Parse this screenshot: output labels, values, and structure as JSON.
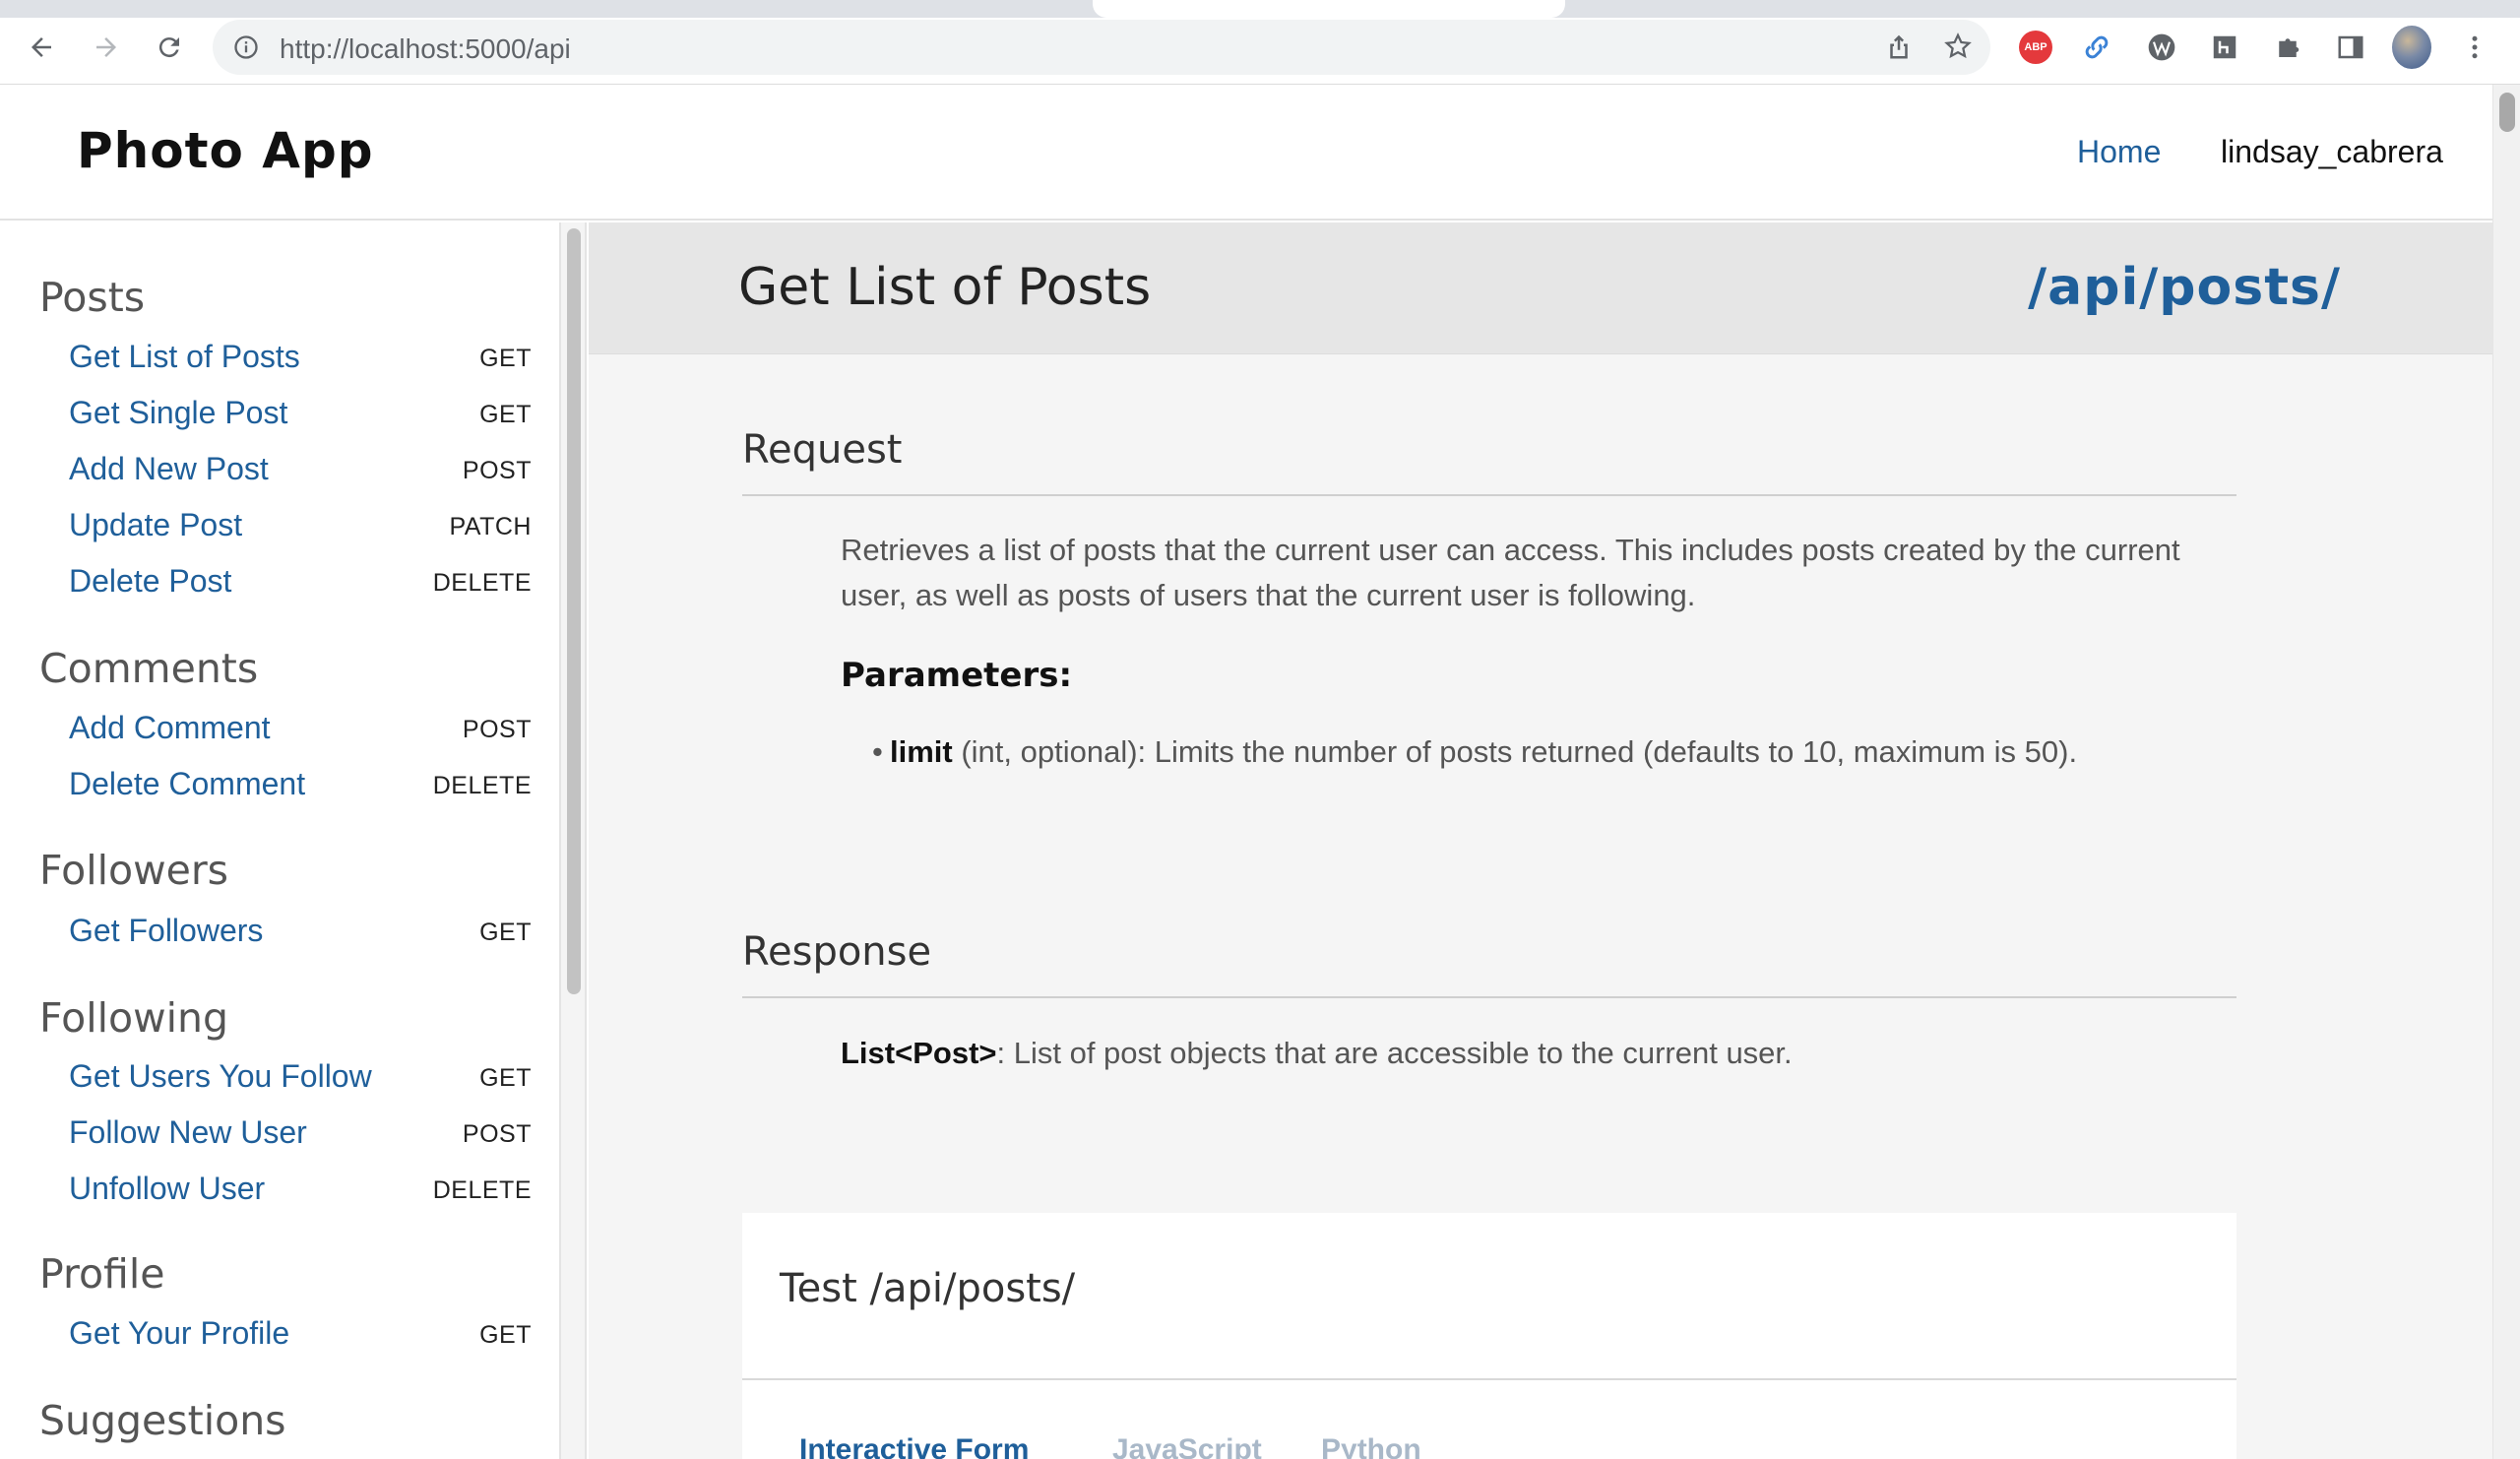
{
  "browser": {
    "url_host": "http://localhost",
    "url_rest": ":5000/api",
    "extensions": {
      "abp_label": "ABP"
    }
  },
  "header": {
    "brand": "Photo App",
    "nav_home": "Home",
    "username": "lindsay_cabrera"
  },
  "sidebar": {
    "sections": [
      {
        "title": "Posts",
        "items": [
          {
            "label": "Get List of Posts",
            "method": "GET"
          },
          {
            "label": "Get Single Post",
            "method": "GET"
          },
          {
            "label": "Add New Post",
            "method": "POST"
          },
          {
            "label": "Update Post",
            "method": "PATCH"
          },
          {
            "label": "Delete Post",
            "method": "DELETE"
          }
        ]
      },
      {
        "title": "Comments",
        "items": [
          {
            "label": "Add Comment",
            "method": "POST"
          },
          {
            "label": "Delete Comment",
            "method": "DELETE"
          }
        ]
      },
      {
        "title": "Followers",
        "items": [
          {
            "label": "Get Followers",
            "method": "GET"
          }
        ]
      },
      {
        "title": "Following",
        "items": [
          {
            "label": "Get Users You Follow",
            "method": "GET"
          },
          {
            "label": "Follow New User",
            "method": "POST"
          },
          {
            "label": "Unfollow User",
            "method": "DELETE"
          }
        ]
      },
      {
        "title": "Profile",
        "items": [
          {
            "label": "Get Your Profile",
            "method": "GET"
          }
        ]
      },
      {
        "title": "Suggestions",
        "items": []
      }
    ]
  },
  "main": {
    "title": "Get List of Posts",
    "endpoint": "/api/posts/",
    "request": {
      "heading": "Request",
      "description": "Retrieves a list of posts that the current user can access. This includes posts created by the current user, as well as posts of users that the current user is following.",
      "params_heading": "Parameters:",
      "params": [
        {
          "name": "limit",
          "desc": " (int, optional): Limits the number of posts returned (defaults to 10, maximum is 50)."
        }
      ]
    },
    "response": {
      "heading": "Response",
      "type": "List<Post>",
      "desc": ": List of post objects that are accessible to the current user."
    },
    "test": {
      "title": "Test /api/posts/",
      "tabs": [
        "Interactive Form",
        "JavaScript",
        "Python"
      ],
      "active_tab": "Interactive Form"
    }
  },
  "colors": {
    "link": "#1f5f9a",
    "title_band": "#e6e6e6",
    "content_bg": "#f5f5f5"
  }
}
